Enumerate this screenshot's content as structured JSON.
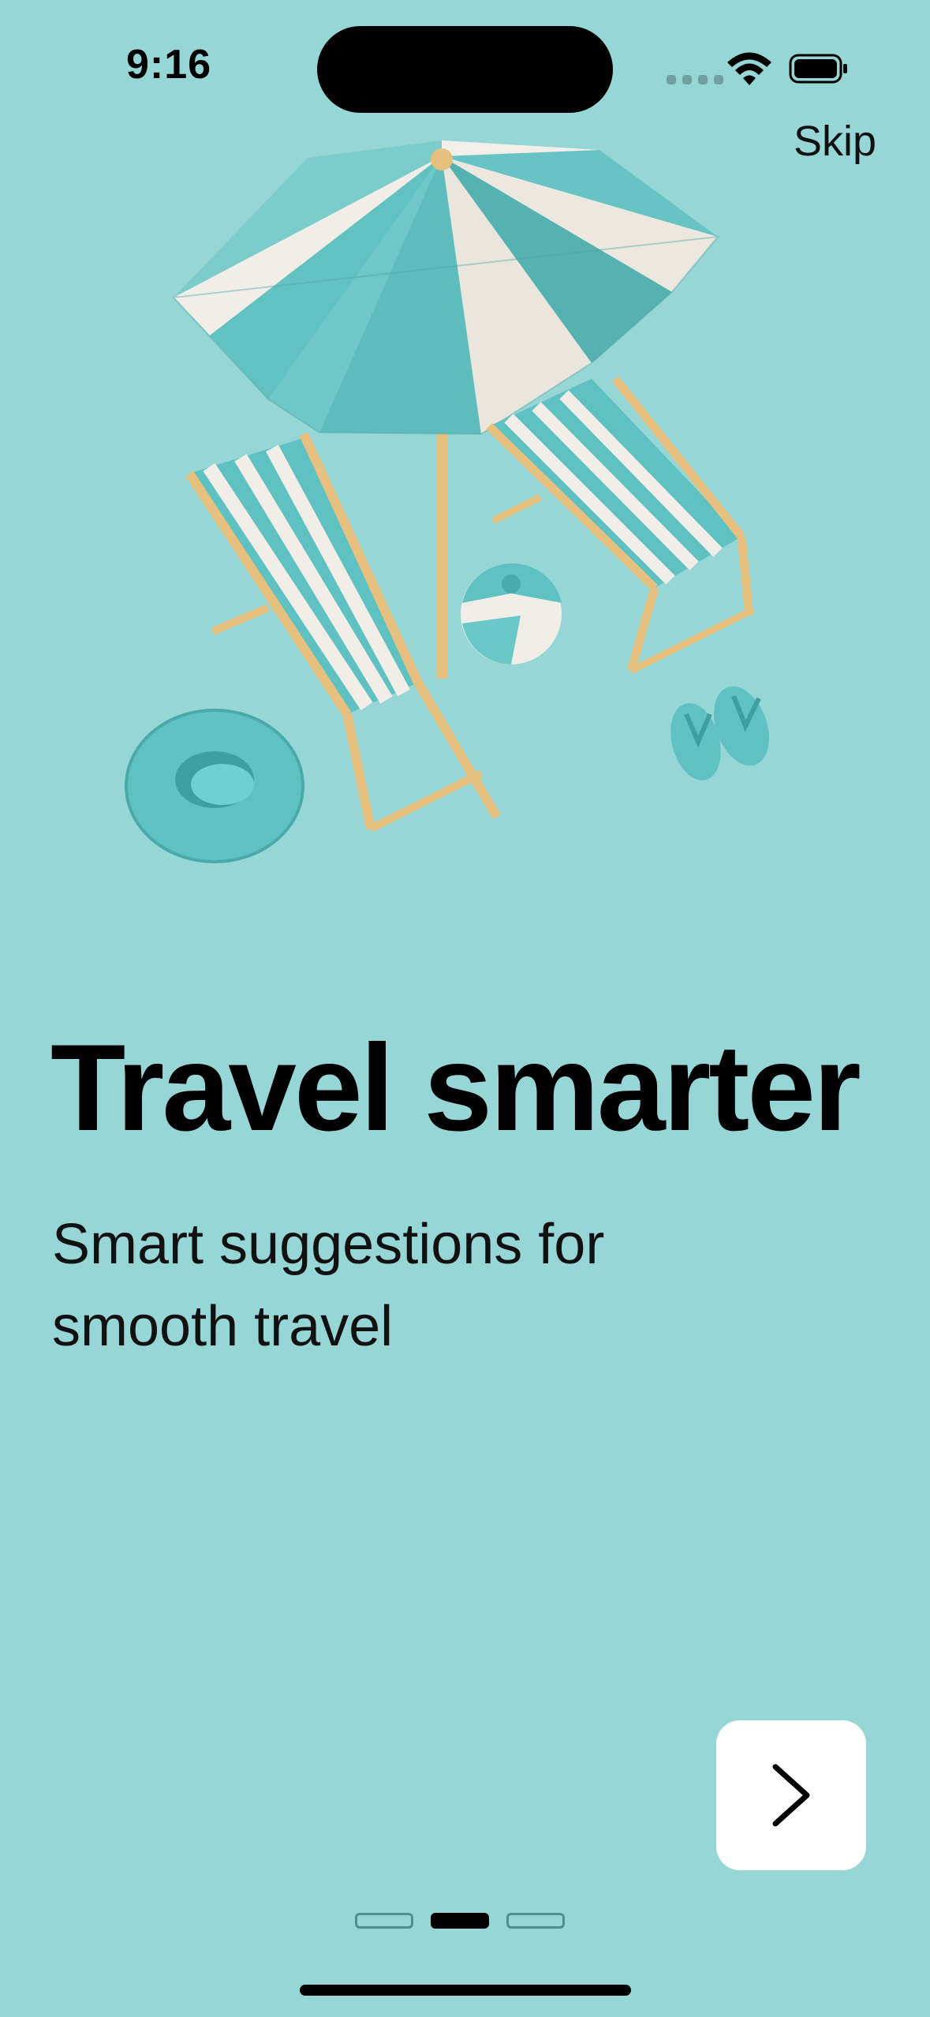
{
  "status_bar": {
    "time": "9:16"
  },
  "header": {
    "skip_label": "Skip"
  },
  "content": {
    "title": "Travel smarter",
    "subtitle": "Smart suggestions for smooth travel"
  },
  "pagination": {
    "total": 3,
    "current": 2
  },
  "icons": {
    "next": "chevron-right-icon",
    "wifi": "wifi-icon",
    "battery": "battery-icon",
    "signal": "signal-icon"
  },
  "colors": {
    "background": "#96d6d6",
    "teal": "#5fc1c1",
    "cream": "#ece7df",
    "wood": "#e6c07e"
  }
}
